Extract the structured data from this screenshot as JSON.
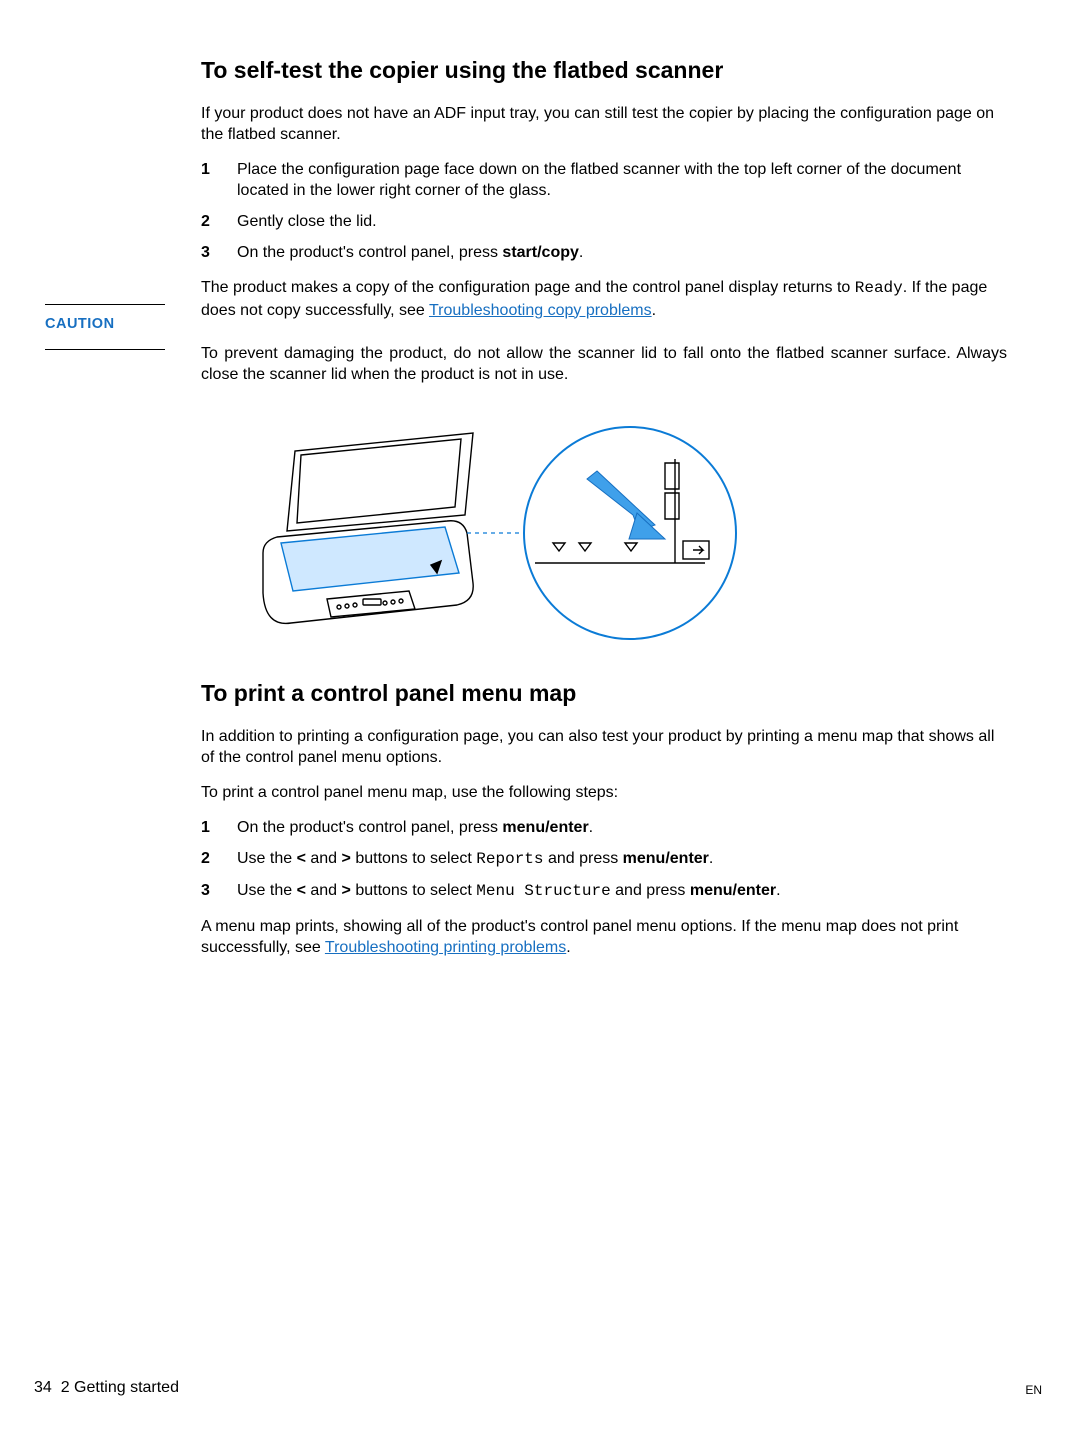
{
  "section1": {
    "heading": "To self-test the copier using the flatbed scanner",
    "intro": "If your product does not have an ADF input tray, you can still test the copier by placing the configuration page on the flatbed scanner.",
    "steps": [
      {
        "num": "1",
        "text": "Place the configuration page face down on the flatbed scanner with the top left corner of the document located in the lower right corner of the glass."
      },
      {
        "num": "2",
        "text": "Gently close the lid."
      },
      {
        "num": "3",
        "pre": "On the product's control panel, press ",
        "bold": "start/copy",
        "post": "."
      }
    ],
    "result_pre": "The product makes a copy of the configuration page and the control panel display returns to ",
    "result_ready": "Ready",
    "result_mid": ". If the page does not copy successfully, see ",
    "result_link": "Troubleshooting copy problems",
    "result_post": "."
  },
  "caution": {
    "label": "CAUTION",
    "text": "To prevent damaging the product, do not allow the scanner lid to fall onto the flatbed scanner surface. Always close the scanner lid when the product is not in use."
  },
  "section2": {
    "heading": "To print a control panel menu map",
    "intro": "In addition to printing a configuration page, you can also test your product by printing a menu map that shows all of the control panel menu options.",
    "lead": "To print a control panel menu map, use the following steps:",
    "steps": {
      "s1": {
        "num": "1",
        "pre": "On the product's control panel, press ",
        "bold": "menu/enter",
        "post": "."
      },
      "s2": {
        "num": "2",
        "pre": "Use the ",
        "lt": "<",
        "and": " and ",
        "gt": ">",
        "mid": " buttons to select ",
        "mono": "Reports",
        "mid2": " and press ",
        "bold": "menu/enter",
        "post": "."
      },
      "s3": {
        "num": "3",
        "pre": "Use the ",
        "lt": "<",
        "and": " and ",
        "gt": ">",
        "mid": " buttons to select ",
        "mono": "Menu Structure",
        "mid2": " and press ",
        "bold": "menu/enter",
        "post": "."
      }
    },
    "result_pre": "A menu map prints, showing all of the product's control panel menu options. If the menu map does not print successfully, see ",
    "result_link": "Troubleshooting printing problems",
    "result_post": "."
  },
  "footer": {
    "page_num": "34",
    "chapter": "2 Getting started",
    "lang": "EN"
  },
  "icons": {
    "printer": "printer-open-lid-icon",
    "detail": "document-placement-detail-icon",
    "arrow": "placement-arrow-icon"
  }
}
